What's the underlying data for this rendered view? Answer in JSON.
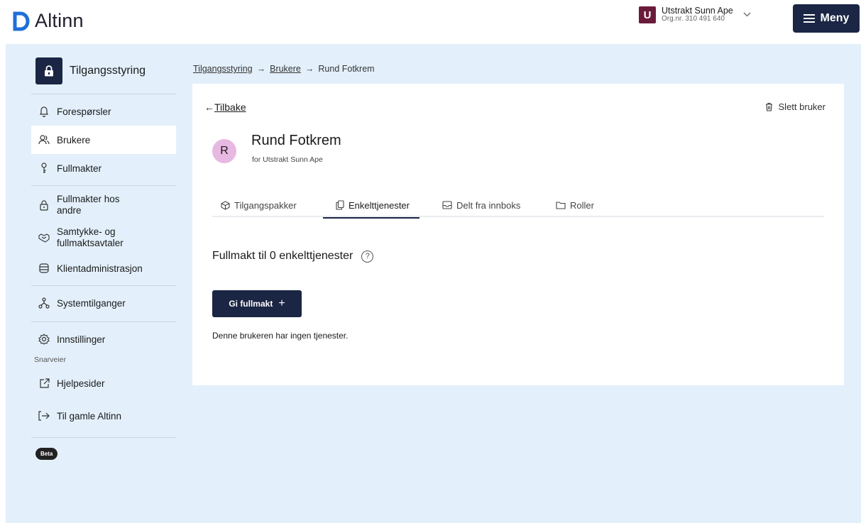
{
  "header": {
    "logo_text": "Altinn",
    "account": {
      "initial": "U",
      "name": "Utstrakt Sunn Ape",
      "org": "Org.nr. 310 491 640"
    },
    "menu_label": "Meny",
    "colors": {
      "navy": "#1b2544",
      "brand_blue": "#1f6fd8",
      "account_badge": "#6a1b3a"
    }
  },
  "sidebar": {
    "title": "Tilgangsstyring",
    "items": [
      {
        "label": "Forespørsler",
        "icon": "bell-icon"
      },
      {
        "label": "Brukere",
        "icon": "users-icon",
        "active": true
      },
      {
        "label": "Fullmakter",
        "icon": "key-icon"
      },
      {
        "label": "Fullmakter hos andre",
        "icon": "lock-icon"
      },
      {
        "label": "Samtykke- og fullmaktsavtaler",
        "icon": "handshake-icon"
      },
      {
        "label": "Klientadministrasjon",
        "icon": "database-icon"
      },
      {
        "label": "Systemtilganger",
        "icon": "network-icon"
      },
      {
        "label": "Innstillinger",
        "icon": "gear-icon"
      }
    ],
    "shortcuts_label": "Snarveier",
    "shortcuts": [
      {
        "label": "Hjelpesider",
        "icon": "external-link-icon"
      },
      {
        "label": "Til gamle Altinn",
        "icon": "enter-icon"
      }
    ],
    "beta_label": "Beta"
  },
  "breadcrumb": {
    "items": [
      "Tilgangsstyring",
      "Brukere",
      "Rund Fotkrem"
    ]
  },
  "card": {
    "back_label": "Tilbake",
    "delete_label": "Slett bruker",
    "user": {
      "initial": "R",
      "name": "Rund Fotkrem",
      "for_text": "for Utstrakt Sunn Ape"
    },
    "tabs": [
      {
        "label": "Tilgangspakker",
        "icon": "package-icon"
      },
      {
        "label": "Enkelttjenester",
        "icon": "copy-icon",
        "active": true
      },
      {
        "label": "Delt fra innboks",
        "icon": "inbox-icon"
      },
      {
        "label": "Roller",
        "icon": "folder-icon"
      }
    ],
    "section_title": "Fullmakt til 0 enkelttjenester",
    "help_glyph": "?",
    "give_button_label": "Gi fullmakt",
    "empty_text": "Denne brukeren har ingen tjenester."
  }
}
